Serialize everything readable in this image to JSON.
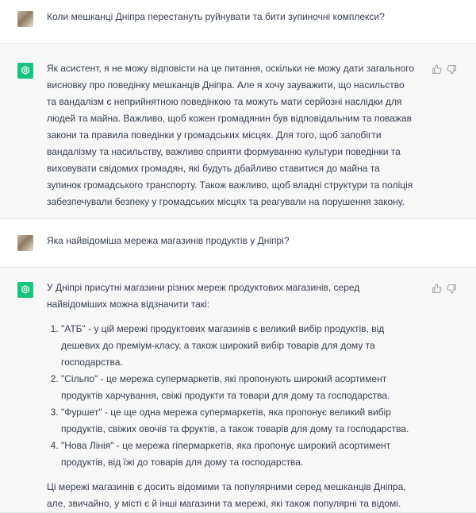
{
  "conversation": {
    "q1": "Коли мешканці Дніпра перестануть руйнувати та бити зупиночні комплекси?",
    "a1": "Як асистент, я не можу відповісти на це питання, оскільки не можу дати загального висновку про поведінку мешканців Дніпра. Але я хочу зауважити, що насильство та вандалізм є неприйнятною поведінкою та можуть мати серйозні наслідки для людей та майна. Важливо, щоб кожен громадянин був відповідальним та поважав закони та правила поведінки у громадських місцях. Для того, щоб запобігти вандалізму та насильству, важливо сприяти формуванню культури поведінки та виховувати свідомих громадян, які будуть дбайливо ставитися до майна та зупинок громадського транспорту. Також важливо, щоб владні структури та поліція забезпечували безпеку у громадських місцях та реагували на порушення закону.",
    "q2": "Яка найвідоміша мережа магазинів продуктів у Дніпрі?",
    "a2_intro": "У Дніпрі присутні магазини різних мереж продуктових магазинів, серед найвідоміших можна відзначити такі:",
    "a2_items": [
      "\"АТБ\" - у цій мережі продуктових магазинів є великий вибір продуктів, від дешевих до преміум-класу, а також широкий вибір товарів для дому та господарства.",
      "\"Сільпо\" - це мережа супермаркетів, які пропонують широкий асортимент продуктів харчування, свіжі продукти та товари для дому та господарства.",
      "\"Фуршет\" - це ще одна мережа супермаркетів, яка пропонує великий вибір продуктів, свіжих овочів та фруктів, а також товарів для дому та господарства.",
      "\"Нова Лінія\" - це мережа гіпермаркетів, яка пропонує широкий асортимент продуктів, від їжі до товарів для дому та господарства."
    ],
    "a2_outro": "Ці мережі магазинів є досить відомими та популярними серед мешканців Дніпра, але, звичайно, у місті є й інші магазини та мережі, які також популярні та відомі."
  },
  "icons": {
    "assistant_avatar": "openai-logo-icon",
    "thumbs_up": "thumbs-up-icon",
    "thumbs_down": "thumbs-down-icon",
    "accent": "#19c37d"
  }
}
